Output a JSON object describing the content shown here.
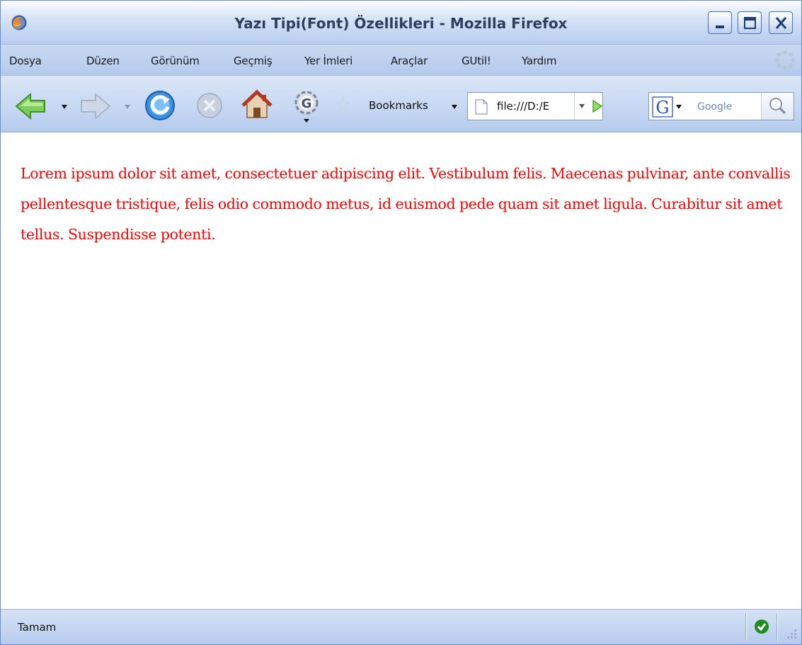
{
  "window": {
    "title": "Yazı Tipi(Font) Özellikleri - Mozilla Firefox",
    "icon": "firefox-logo-icon"
  },
  "menu": {
    "items": [
      {
        "label": "Dosya"
      },
      {
        "label": "Düzen"
      },
      {
        "label": "Görünüm"
      },
      {
        "label": "Geçmiş"
      },
      {
        "label": "Yer İmleri"
      },
      {
        "label": "Araçlar"
      },
      {
        "label": "GUtil!"
      },
      {
        "label": "Yardım"
      }
    ]
  },
  "toolbar": {
    "icons": [
      "back-arrow-icon",
      "forward-arrow-icon",
      "reload-icon",
      "stop-icon",
      "home-icon",
      "gutil-gear-icon"
    ],
    "bookmarks_label": "Bookmarks",
    "url": "file:///D:/E",
    "search_placeholder": "Google"
  },
  "content": {
    "paragraph": "Lorem ipsum dolor sit amet, consectetuer adipiscing elit. Vestibulum felis. Maecenas pulvinar, ante convallis pellentesque tristique, felis odio commodo metus, id euismod pede quam sit amet ligula. Curabitur sit amet tellus. Suspendisse potenti.",
    "text_color": "#ff0000"
  },
  "status": {
    "text": "Tamam"
  },
  "colors": {
    "chrome_blue": "#c6d8f3",
    "border_blue": "#6d8fc7",
    "text_red": "#ff0000"
  }
}
